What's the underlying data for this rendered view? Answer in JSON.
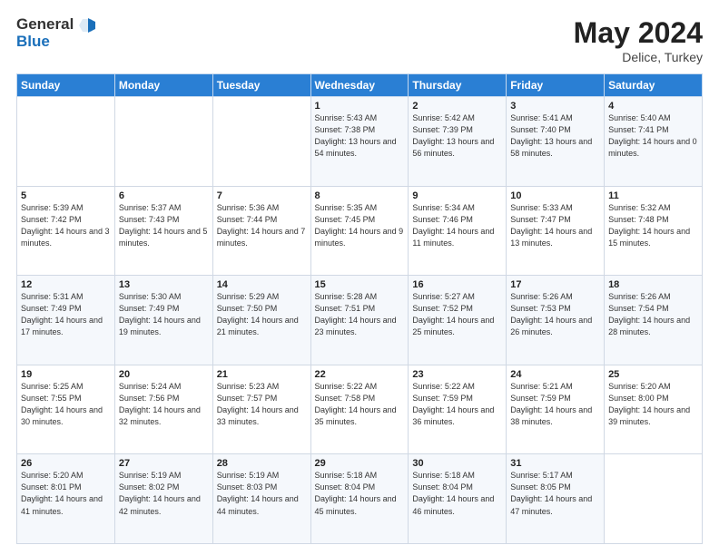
{
  "header": {
    "logo_line1": "General",
    "logo_line2": "Blue",
    "month_year": "May 2024",
    "location": "Delice, Turkey"
  },
  "days_of_week": [
    "Sunday",
    "Monday",
    "Tuesday",
    "Wednesday",
    "Thursday",
    "Friday",
    "Saturday"
  ],
  "weeks": [
    [
      {
        "day": "",
        "sunrise": "",
        "sunset": "",
        "daylight": ""
      },
      {
        "day": "",
        "sunrise": "",
        "sunset": "",
        "daylight": ""
      },
      {
        "day": "",
        "sunrise": "",
        "sunset": "",
        "daylight": ""
      },
      {
        "day": "1",
        "sunrise": "Sunrise: 5:43 AM",
        "sunset": "Sunset: 7:38 PM",
        "daylight": "Daylight: 13 hours and 54 minutes."
      },
      {
        "day": "2",
        "sunrise": "Sunrise: 5:42 AM",
        "sunset": "Sunset: 7:39 PM",
        "daylight": "Daylight: 13 hours and 56 minutes."
      },
      {
        "day": "3",
        "sunrise": "Sunrise: 5:41 AM",
        "sunset": "Sunset: 7:40 PM",
        "daylight": "Daylight: 13 hours and 58 minutes."
      },
      {
        "day": "4",
        "sunrise": "Sunrise: 5:40 AM",
        "sunset": "Sunset: 7:41 PM",
        "daylight": "Daylight: 14 hours and 0 minutes."
      }
    ],
    [
      {
        "day": "5",
        "sunrise": "Sunrise: 5:39 AM",
        "sunset": "Sunset: 7:42 PM",
        "daylight": "Daylight: 14 hours and 3 minutes."
      },
      {
        "day": "6",
        "sunrise": "Sunrise: 5:37 AM",
        "sunset": "Sunset: 7:43 PM",
        "daylight": "Daylight: 14 hours and 5 minutes."
      },
      {
        "day": "7",
        "sunrise": "Sunrise: 5:36 AM",
        "sunset": "Sunset: 7:44 PM",
        "daylight": "Daylight: 14 hours and 7 minutes."
      },
      {
        "day": "8",
        "sunrise": "Sunrise: 5:35 AM",
        "sunset": "Sunset: 7:45 PM",
        "daylight": "Daylight: 14 hours and 9 minutes."
      },
      {
        "day": "9",
        "sunrise": "Sunrise: 5:34 AM",
        "sunset": "Sunset: 7:46 PM",
        "daylight": "Daylight: 14 hours and 11 minutes."
      },
      {
        "day": "10",
        "sunrise": "Sunrise: 5:33 AM",
        "sunset": "Sunset: 7:47 PM",
        "daylight": "Daylight: 14 hours and 13 minutes."
      },
      {
        "day": "11",
        "sunrise": "Sunrise: 5:32 AM",
        "sunset": "Sunset: 7:48 PM",
        "daylight": "Daylight: 14 hours and 15 minutes."
      }
    ],
    [
      {
        "day": "12",
        "sunrise": "Sunrise: 5:31 AM",
        "sunset": "Sunset: 7:49 PM",
        "daylight": "Daylight: 14 hours and 17 minutes."
      },
      {
        "day": "13",
        "sunrise": "Sunrise: 5:30 AM",
        "sunset": "Sunset: 7:49 PM",
        "daylight": "Daylight: 14 hours and 19 minutes."
      },
      {
        "day": "14",
        "sunrise": "Sunrise: 5:29 AM",
        "sunset": "Sunset: 7:50 PM",
        "daylight": "Daylight: 14 hours and 21 minutes."
      },
      {
        "day": "15",
        "sunrise": "Sunrise: 5:28 AM",
        "sunset": "Sunset: 7:51 PM",
        "daylight": "Daylight: 14 hours and 23 minutes."
      },
      {
        "day": "16",
        "sunrise": "Sunrise: 5:27 AM",
        "sunset": "Sunset: 7:52 PM",
        "daylight": "Daylight: 14 hours and 25 minutes."
      },
      {
        "day": "17",
        "sunrise": "Sunrise: 5:26 AM",
        "sunset": "Sunset: 7:53 PM",
        "daylight": "Daylight: 14 hours and 26 minutes."
      },
      {
        "day": "18",
        "sunrise": "Sunrise: 5:26 AM",
        "sunset": "Sunset: 7:54 PM",
        "daylight": "Daylight: 14 hours and 28 minutes."
      }
    ],
    [
      {
        "day": "19",
        "sunrise": "Sunrise: 5:25 AM",
        "sunset": "Sunset: 7:55 PM",
        "daylight": "Daylight: 14 hours and 30 minutes."
      },
      {
        "day": "20",
        "sunrise": "Sunrise: 5:24 AM",
        "sunset": "Sunset: 7:56 PM",
        "daylight": "Daylight: 14 hours and 32 minutes."
      },
      {
        "day": "21",
        "sunrise": "Sunrise: 5:23 AM",
        "sunset": "Sunset: 7:57 PM",
        "daylight": "Daylight: 14 hours and 33 minutes."
      },
      {
        "day": "22",
        "sunrise": "Sunrise: 5:22 AM",
        "sunset": "Sunset: 7:58 PM",
        "daylight": "Daylight: 14 hours and 35 minutes."
      },
      {
        "day": "23",
        "sunrise": "Sunrise: 5:22 AM",
        "sunset": "Sunset: 7:59 PM",
        "daylight": "Daylight: 14 hours and 36 minutes."
      },
      {
        "day": "24",
        "sunrise": "Sunrise: 5:21 AM",
        "sunset": "Sunset: 7:59 PM",
        "daylight": "Daylight: 14 hours and 38 minutes."
      },
      {
        "day": "25",
        "sunrise": "Sunrise: 5:20 AM",
        "sunset": "Sunset: 8:00 PM",
        "daylight": "Daylight: 14 hours and 39 minutes."
      }
    ],
    [
      {
        "day": "26",
        "sunrise": "Sunrise: 5:20 AM",
        "sunset": "Sunset: 8:01 PM",
        "daylight": "Daylight: 14 hours and 41 minutes."
      },
      {
        "day": "27",
        "sunrise": "Sunrise: 5:19 AM",
        "sunset": "Sunset: 8:02 PM",
        "daylight": "Daylight: 14 hours and 42 minutes."
      },
      {
        "day": "28",
        "sunrise": "Sunrise: 5:19 AM",
        "sunset": "Sunset: 8:03 PM",
        "daylight": "Daylight: 14 hours and 44 minutes."
      },
      {
        "day": "29",
        "sunrise": "Sunrise: 5:18 AM",
        "sunset": "Sunset: 8:04 PM",
        "daylight": "Daylight: 14 hours and 45 minutes."
      },
      {
        "day": "30",
        "sunrise": "Sunrise: 5:18 AM",
        "sunset": "Sunset: 8:04 PM",
        "daylight": "Daylight: 14 hours and 46 minutes."
      },
      {
        "day": "31",
        "sunrise": "Sunrise: 5:17 AM",
        "sunset": "Sunset: 8:05 PM",
        "daylight": "Daylight: 14 hours and 47 minutes."
      },
      {
        "day": "",
        "sunrise": "",
        "sunset": "",
        "daylight": ""
      }
    ]
  ]
}
